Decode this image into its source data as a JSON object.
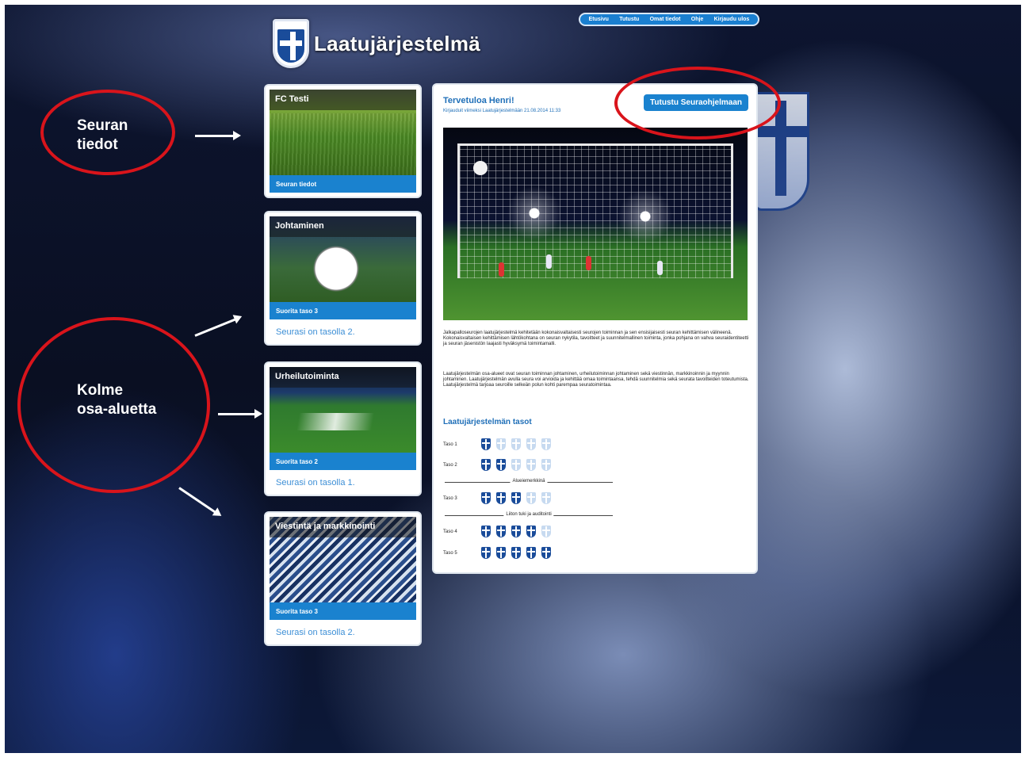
{
  "app": {
    "title": "Laatujärjestelmä"
  },
  "nav": {
    "items": [
      "Etusivu",
      "Tutustu",
      "Omat tiedot",
      "Ohje",
      "Kirjaudu ulos"
    ]
  },
  "cards": [
    {
      "title": "FC Testi",
      "bar": "Seuran tiedot",
      "level": ""
    },
    {
      "title": "Johtaminen",
      "bar": "Suorita taso 3",
      "level": "Seurasi on tasolla 2."
    },
    {
      "title": "Urheilutoiminta",
      "bar": "Suorita taso 2",
      "level": "Seurasi on tasolla 1."
    },
    {
      "title": "Viestintä ja markkinointi",
      "bar": "Suorita taso 3",
      "level": "Seurasi on tasolla 2."
    }
  ],
  "main": {
    "welcome": "Tervetuloa Henri!",
    "last_login": "Kirjauduit viimeksi Laatujärjestelmään 21.08.2014 11:33",
    "intro_button": "Tutustu Seuraohjelmaan",
    "paragraph1": "Jalkapalloseurojen laatujärjestelmä kehitetään kokonaisvaltaisesti seurojen toiminnan ja sen ensisijaisesti seuran kehittämisen välineenä. Kokonaisvaltaisen kehittämisen lähtökohtana on seuran nykytila, tavoitteet ja suunnitelmallinen toiminta, jonka pohjana on vahva seuraidentiteetti ja seuran jäsenistön laajasti hyväksymä toimintamalli.",
    "paragraph2": "Laatujärjestelmän osa-alueet ovat seuran toiminnan johtaminen, urheilutoiminnan johtaminen sekä viestinnän, markkinoinnin ja myynnin johtaminen. Laatujärjestelmän avulla seura voi arvioida ja kehittää omaa toimintaansa, tehdä suunnitelmia sekä seurata tavoitteiden toteutumista. Laatujärjestelmä tarjoaa seuroille selkeän polun kohti parempaa seuratoimintaa.",
    "levels_title": "Laatujärjestelmän tasot",
    "levels": [
      {
        "label": "Taso 1",
        "filled": 1
      },
      {
        "label": "Taso 2",
        "filled": 2
      },
      {
        "label": "Taso 3",
        "filled": 3
      },
      {
        "label": "Taso 4",
        "filled": 4
      },
      {
        "label": "Taso 5",
        "filled": 5
      }
    ],
    "sep1": "Alueiemerkkinä",
    "sep2": "Liiton tuki ja auditointi"
  },
  "annotations": {
    "seuran_tiedot": "Seuran\ntiedot",
    "kolme": "Kolme\nosa-aluetta"
  },
  "colors": {
    "accent": "#1a82cf",
    "ring": "#d9141b"
  }
}
